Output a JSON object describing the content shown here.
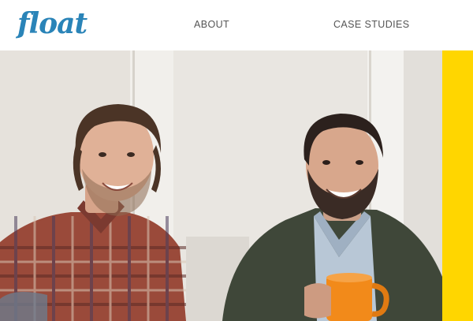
{
  "brand": {
    "logo_text": "float",
    "color": "#2a84b8"
  },
  "nav": {
    "items": [
      {
        "label": "ABOUT"
      },
      {
        "label": "CASE STUDIES"
      }
    ]
  },
  "hero": {
    "accent_color": "#ffd600",
    "image_subject": "two smiling men, one in a plaid shirt and one holding an orange mug"
  }
}
